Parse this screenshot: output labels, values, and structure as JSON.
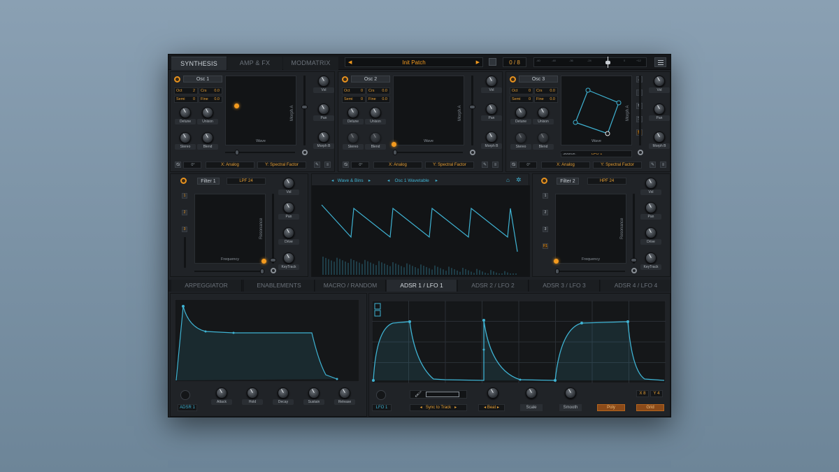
{
  "tabs": {
    "synthesis": "SYNTHESIS",
    "ampfx": "AMP & FX",
    "modmatrix": "MODMATRIX"
  },
  "patch": {
    "name": "Init Patch",
    "prev": "◀",
    "next": "▶"
  },
  "voices": "0 / 8",
  "meter_labels": [
    "-60",
    "-48",
    "-36",
    "-24",
    "-12",
    "0",
    "+12"
  ],
  "osc": [
    {
      "name": "Osc 1",
      "oct_label": "Oct",
      "oct": "2",
      "crs_label": "Crs",
      "crs": "0.0",
      "semi_label": "Semi",
      "semi": "0",
      "fine_label": "Fine",
      "fine": "0.0",
      "knobs": [
        "Detune",
        "Unison",
        "Stereo",
        "Blend"
      ],
      "pad_label": "Wave",
      "morph_label": "Morph A",
      "right_knobs": [
        "Vol",
        "Pan",
        "Morph B"
      ],
      "x_sel": "X: Analog",
      "y_sel": "Y: Spectral Factor",
      "phase": "0°"
    },
    {
      "name": "Osc 2",
      "oct_label": "Oct",
      "oct": "0",
      "crs_label": "Crs",
      "crs": "0.0",
      "semi_label": "Semi",
      "semi": "0",
      "fine_label": "Fine",
      "fine": "0.0",
      "knobs": [
        "Detune",
        "Unison",
        "Stereo",
        "Blend"
      ],
      "pad_label": "Wave",
      "morph_label": "Morph A",
      "right_knobs": [
        "Vol",
        "Pan",
        "Morph B"
      ],
      "x_sel": "X: Analog",
      "y_sel": "Y: Spectral Factor",
      "phase": "0°"
    },
    {
      "name": "Osc 3",
      "oct_label": "Oct",
      "oct": "0",
      "crs_label": "Crs",
      "crs": "0.0",
      "semi_label": "Semi",
      "semi": "0",
      "fine_label": "Fine",
      "fine": "0.0",
      "knobs": [
        "Detune",
        "Unison",
        "Stereo",
        "Blend"
      ],
      "pad_label": "Wave",
      "morph_label": "Morph A",
      "right_knobs": [
        "Vol",
        "Pan",
        "Morph B"
      ],
      "x_sel": "X: Analog",
      "y_sel": "Y: Spectral Factor",
      "phase": "0°",
      "source_label": "Source:",
      "source": "LFO 1"
    }
  ],
  "filters": [
    {
      "name": "Filter 1",
      "type": "LPF 24",
      "x_label": "Frequency",
      "y_label": "Resonance",
      "knobs": [
        "Vol",
        "Pan",
        "Drive",
        "KeyTrack"
      ],
      "side": [
        "1",
        "2",
        "3"
      ]
    },
    {
      "name": "Filter 2",
      "type": "HPF 24",
      "x_label": "Frequency",
      "y_label": "Resonance",
      "knobs": [
        "Vol",
        "Pan",
        "Drive",
        "KeyTrack"
      ],
      "side": [
        "1",
        "2",
        "3",
        "F1"
      ]
    }
  ],
  "wave_view": {
    "mode": "Wave & Bins",
    "table": "Osc 1 Wavetable"
  },
  "mod_tabs": [
    "ARPEGGIATOR",
    "ENABLEMENTS",
    "MACRO / RANDOM",
    "ADSR 1 / LFO 1",
    "ADSR 2 / LFO 2",
    "ADSR 3 / LFO 3",
    "ADSR 4 / LFO 4"
  ],
  "adsr": {
    "name": "ADSR 1",
    "knobs": [
      "Attack",
      "Hold",
      "Decay",
      "Sustain",
      "Release"
    ]
  },
  "lfo": {
    "name": "LFO 1",
    "sync": "Sync to Track",
    "beat": "Beat",
    "knobs": [
      "Scale",
      "Smooth"
    ],
    "poly": "Poly",
    "grid": "Grid",
    "x": "X 8",
    "y": "Y 4"
  },
  "colors": {
    "accent": "#f39a1e",
    "cyan": "#3fb3d3",
    "bg": "#1e2125"
  }
}
